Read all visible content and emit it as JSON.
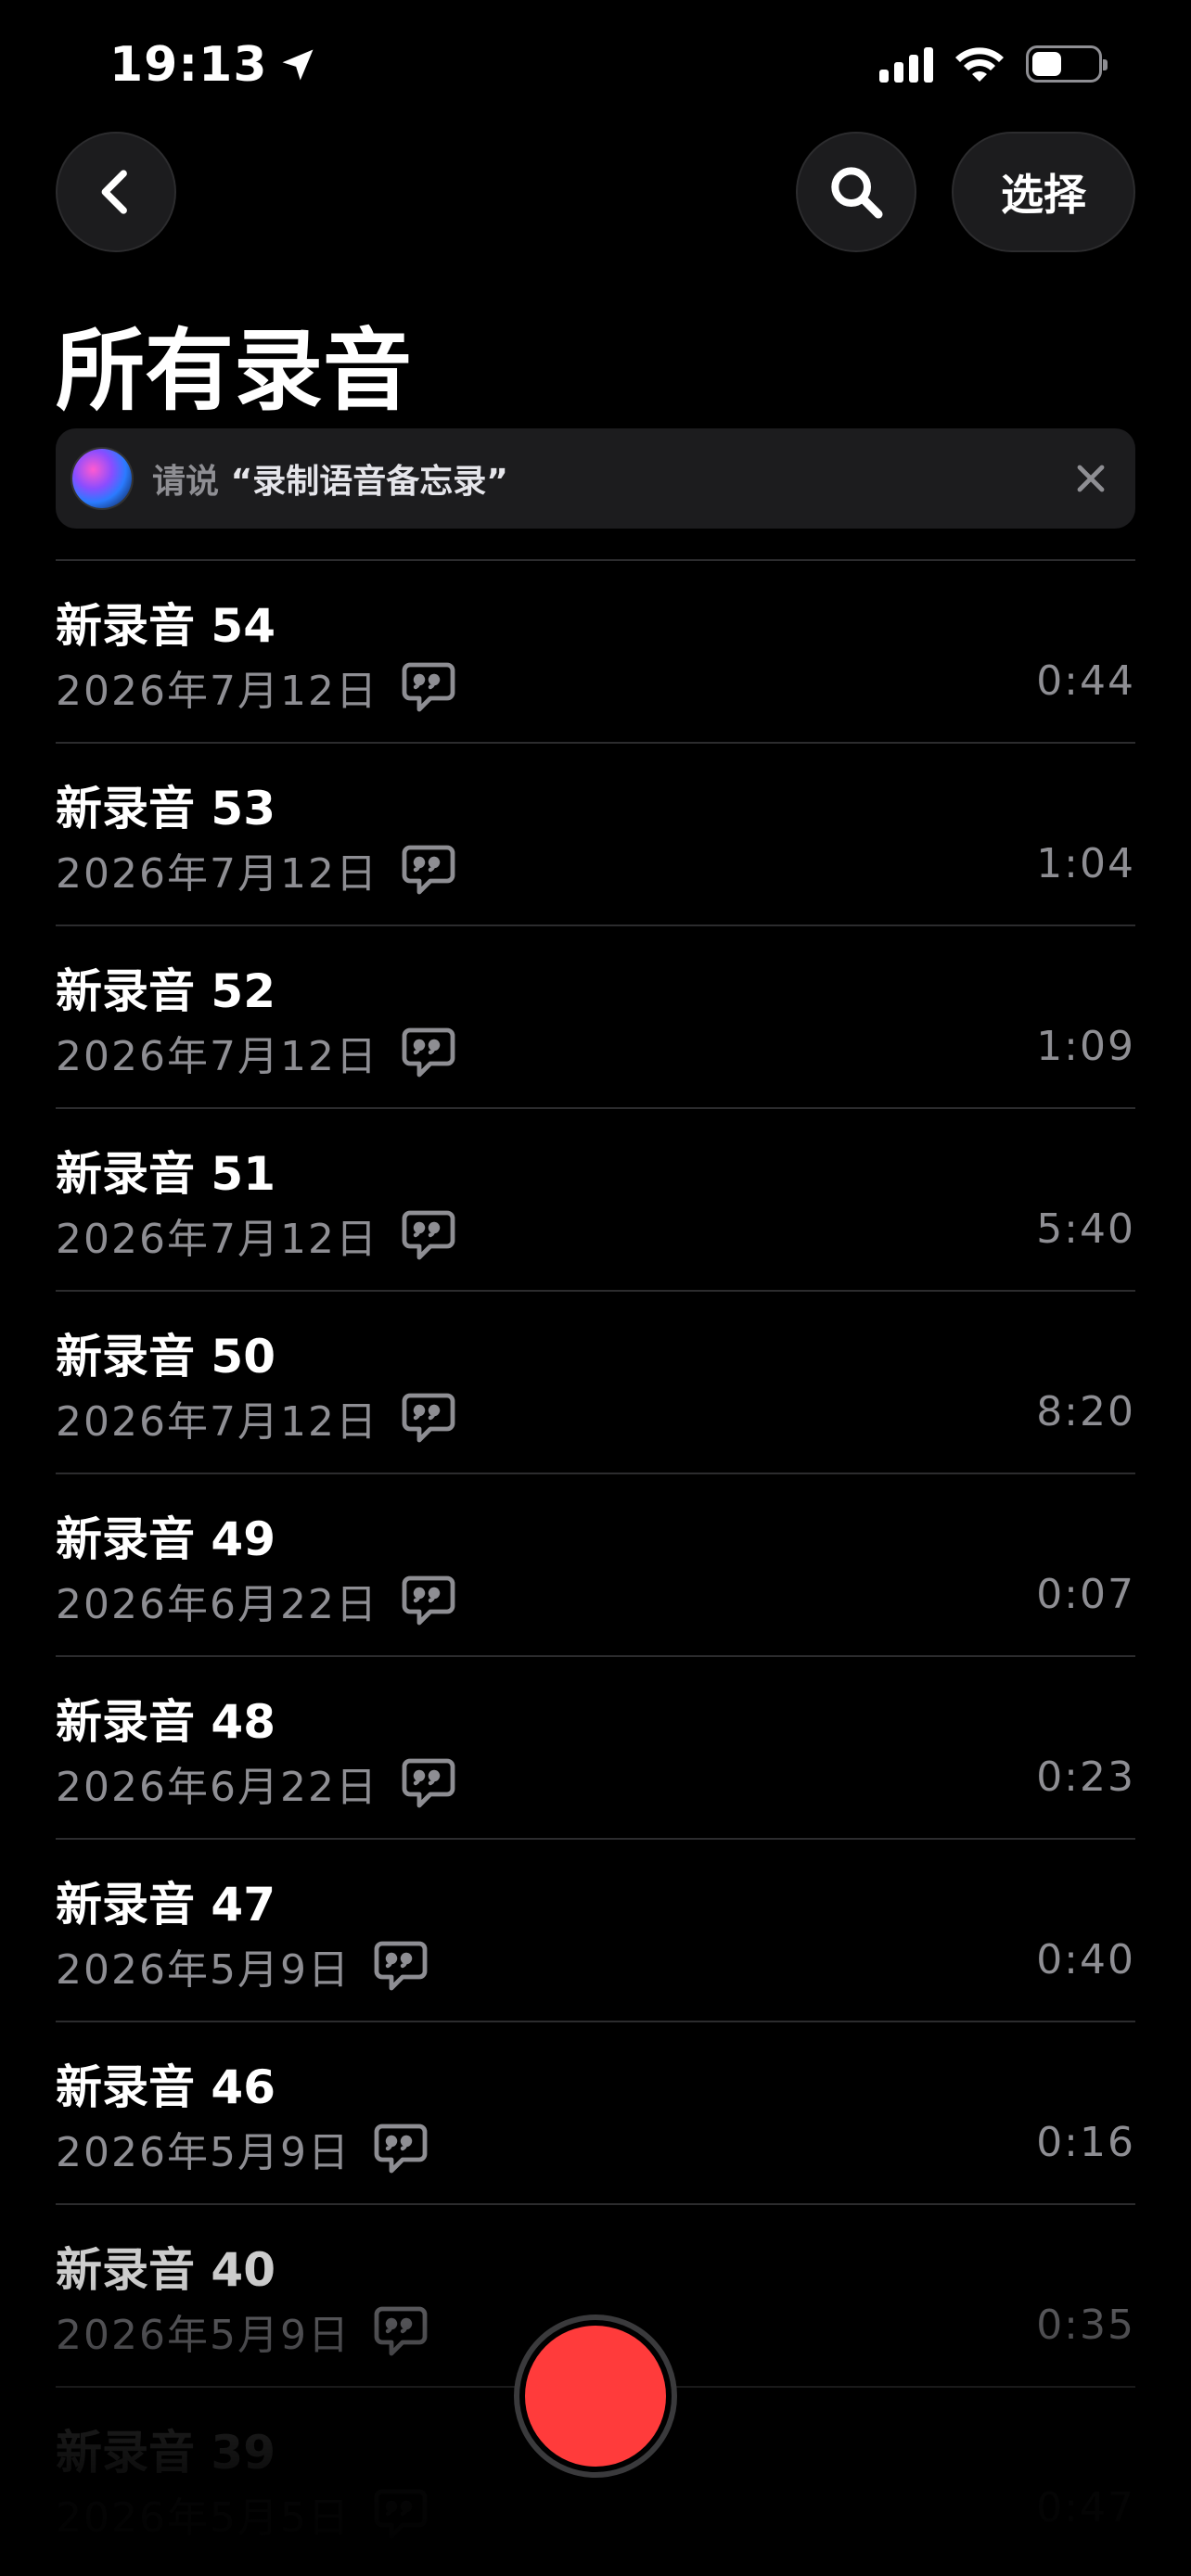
{
  "status_bar": {
    "time": "19:13",
    "battery_level": 0.45
  },
  "nav": {
    "select_label": "选择",
    "back_icon": "chevron-left-icon",
    "search_icon": "search-icon"
  },
  "page": {
    "title": "所有录音"
  },
  "siri_banner": {
    "prefix": "请说",
    "phrase": "“录制语音备忘录”",
    "close_icon": "close-icon"
  },
  "recordings": [
    {
      "title": "新录音 54",
      "date": "2026年7月12日",
      "duration": "0:44"
    },
    {
      "title": "新录音 53",
      "date": "2026年7月12日",
      "duration": "1:04"
    },
    {
      "title": "新录音 52",
      "date": "2026年7月12日",
      "duration": "1:09"
    },
    {
      "title": "新录音 51",
      "date": "2026年7月12日",
      "duration": "5:40"
    },
    {
      "title": "新录音 50",
      "date": "2026年7月12日",
      "duration": "8:20"
    },
    {
      "title": "新录音 49",
      "date": "2026年6月22日",
      "duration": "0:07"
    },
    {
      "title": "新录音 48",
      "date": "2026年6月22日",
      "duration": "0:23"
    },
    {
      "title": "新录音 47",
      "date": "2026年5月9日",
      "duration": "0:40"
    },
    {
      "title": "新录音 46",
      "date": "2026年5月9日",
      "duration": "0:16"
    },
    {
      "title": "新录音 40",
      "date": "2026年5月9日",
      "duration": "0:35"
    },
    {
      "title": "新录音 39",
      "date": "2026年5月5日",
      "duration": "0:47"
    }
  ],
  "colors": {
    "background": "#000000",
    "secondary_text": "#8e8e93",
    "record_red": "#ff3b3b",
    "separator": "#2c2c2e"
  }
}
